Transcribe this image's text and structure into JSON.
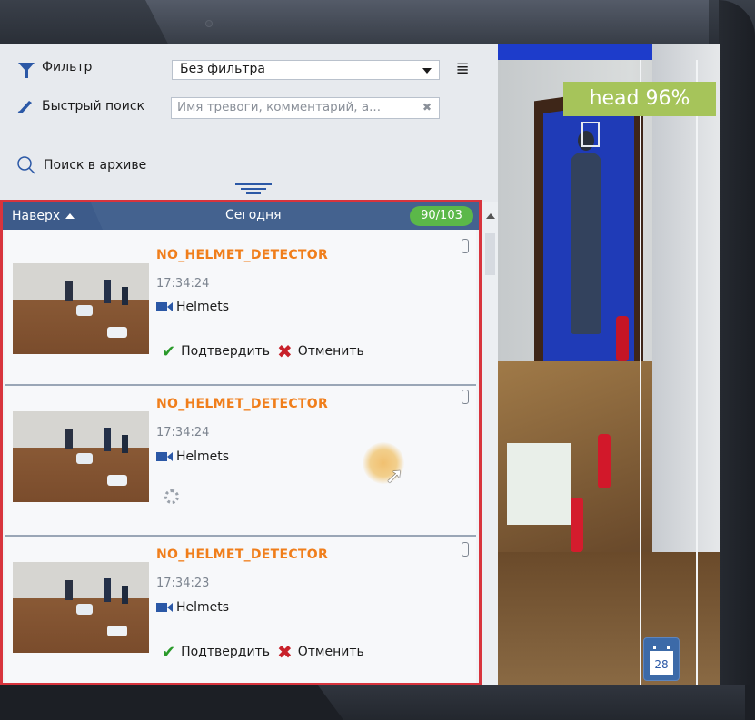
{
  "toolbar": {
    "filter_label": "Фильтр",
    "filter_value": "Без фильтра",
    "quick_search_label": "Быстрый поиск",
    "quick_search_placeholder": "Имя тревоги, комментарий, а...",
    "archive_search_label": "Поиск в архиве"
  },
  "events_header": {
    "top_label": "Наверх",
    "date_label": "Сегодня",
    "count": "90/103"
  },
  "events": [
    {
      "title": "NO_HELMET_DETECTOR",
      "time": "17:34:24",
      "camera": "Helmets",
      "confirm": "Подтвердить",
      "cancel": "Отменить",
      "state": "actions"
    },
    {
      "title": "NO_HELMET_DETECTOR",
      "time": "17:34:24",
      "camera": "Helmets",
      "state": "loading"
    },
    {
      "title": "NO_HELMET_DETECTOR",
      "time": "17:34:23",
      "camera": "Helmets",
      "confirm": "Подтвердить",
      "cancel": "Отменить",
      "state": "actions"
    }
  ],
  "video": {
    "detection_label": "head 96%",
    "calendar_day": "28"
  },
  "colors": {
    "accent": "#2b58a6",
    "alert_title": "#f07e1b",
    "highlight_border": "#d8343d",
    "count_badge": "#5bb849",
    "detection_label_bg": "#a6c45a"
  },
  "icons": [
    "funnel-icon",
    "list-icon",
    "pen-icon",
    "magnifier-icon",
    "clear-icon",
    "camera-icon",
    "check-icon",
    "cross-icon",
    "paperclip-icon",
    "spinner-icon",
    "calendar-icon"
  ]
}
